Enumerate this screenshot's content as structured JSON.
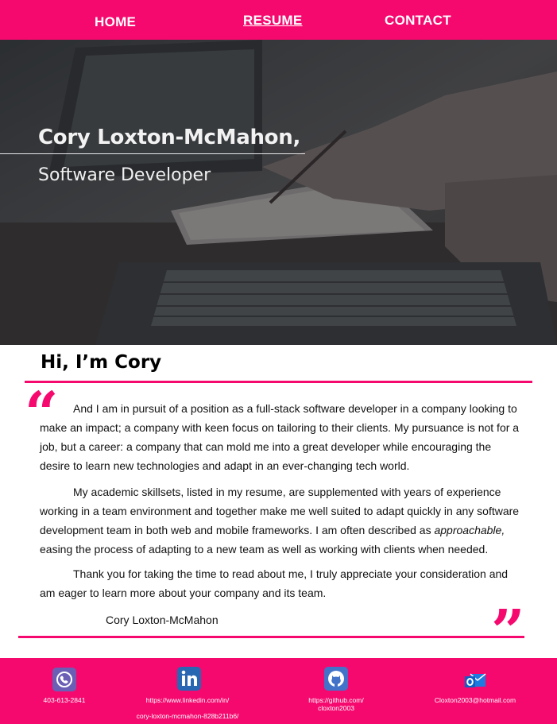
{
  "nav": {
    "home": "HOME",
    "resume": "RESUME",
    "contact": "CONTACT"
  },
  "hero": {
    "name": "Cory Loxton-McMahon,",
    "title": "Software Developer"
  },
  "about": {
    "greeting": "Hi, I’m Cory",
    "open_quote": "“",
    "close_quote": "”",
    "paragraph1": "And I am in pursuit of a position as a full-stack software developer in a company looking to make an impact; a company with keen focus on tailoring to their clients. My pursuance is not for a job, but a career: a company that can mold me into a great developer while encouraging the desire to learn new technologies and adapt in an ever-changing tech world.",
    "paragraph2_before": "My academic skillsets, listed in my resume, are supplemented with years of experience working in a team environment and together make me well suited to adapt quickly in any software development team in both web and mobile frameworks. I am often described as ",
    "paragraph2_emphasis": "approachable,",
    "paragraph2_after": " easing the process of adapting to a new team as well as working with clients when needed.",
    "paragraph3": "Thank you for taking the time to read about me, I truly appreciate your consideration and am eager to learn more about your company and its team.",
    "signature": "Cory Loxton-McMahon"
  },
  "footer": {
    "phone": "403-613-2841",
    "linkedin_line1": "https://www.linkedin.com/in/",
    "linkedin_line2": "cory-loxton-mcmahon-828b211b6/",
    "github_line1": "https://github.com/",
    "github_line2": "cloxton2003",
    "email": "Cloxton2003@hotmail.com",
    "icons": [
      "phone-icon",
      "linkedin-icon",
      "github-icon",
      "outlook-icon"
    ]
  },
  "colors": {
    "accent": "#f5096f",
    "hero_bg": "#3c3c3e"
  }
}
